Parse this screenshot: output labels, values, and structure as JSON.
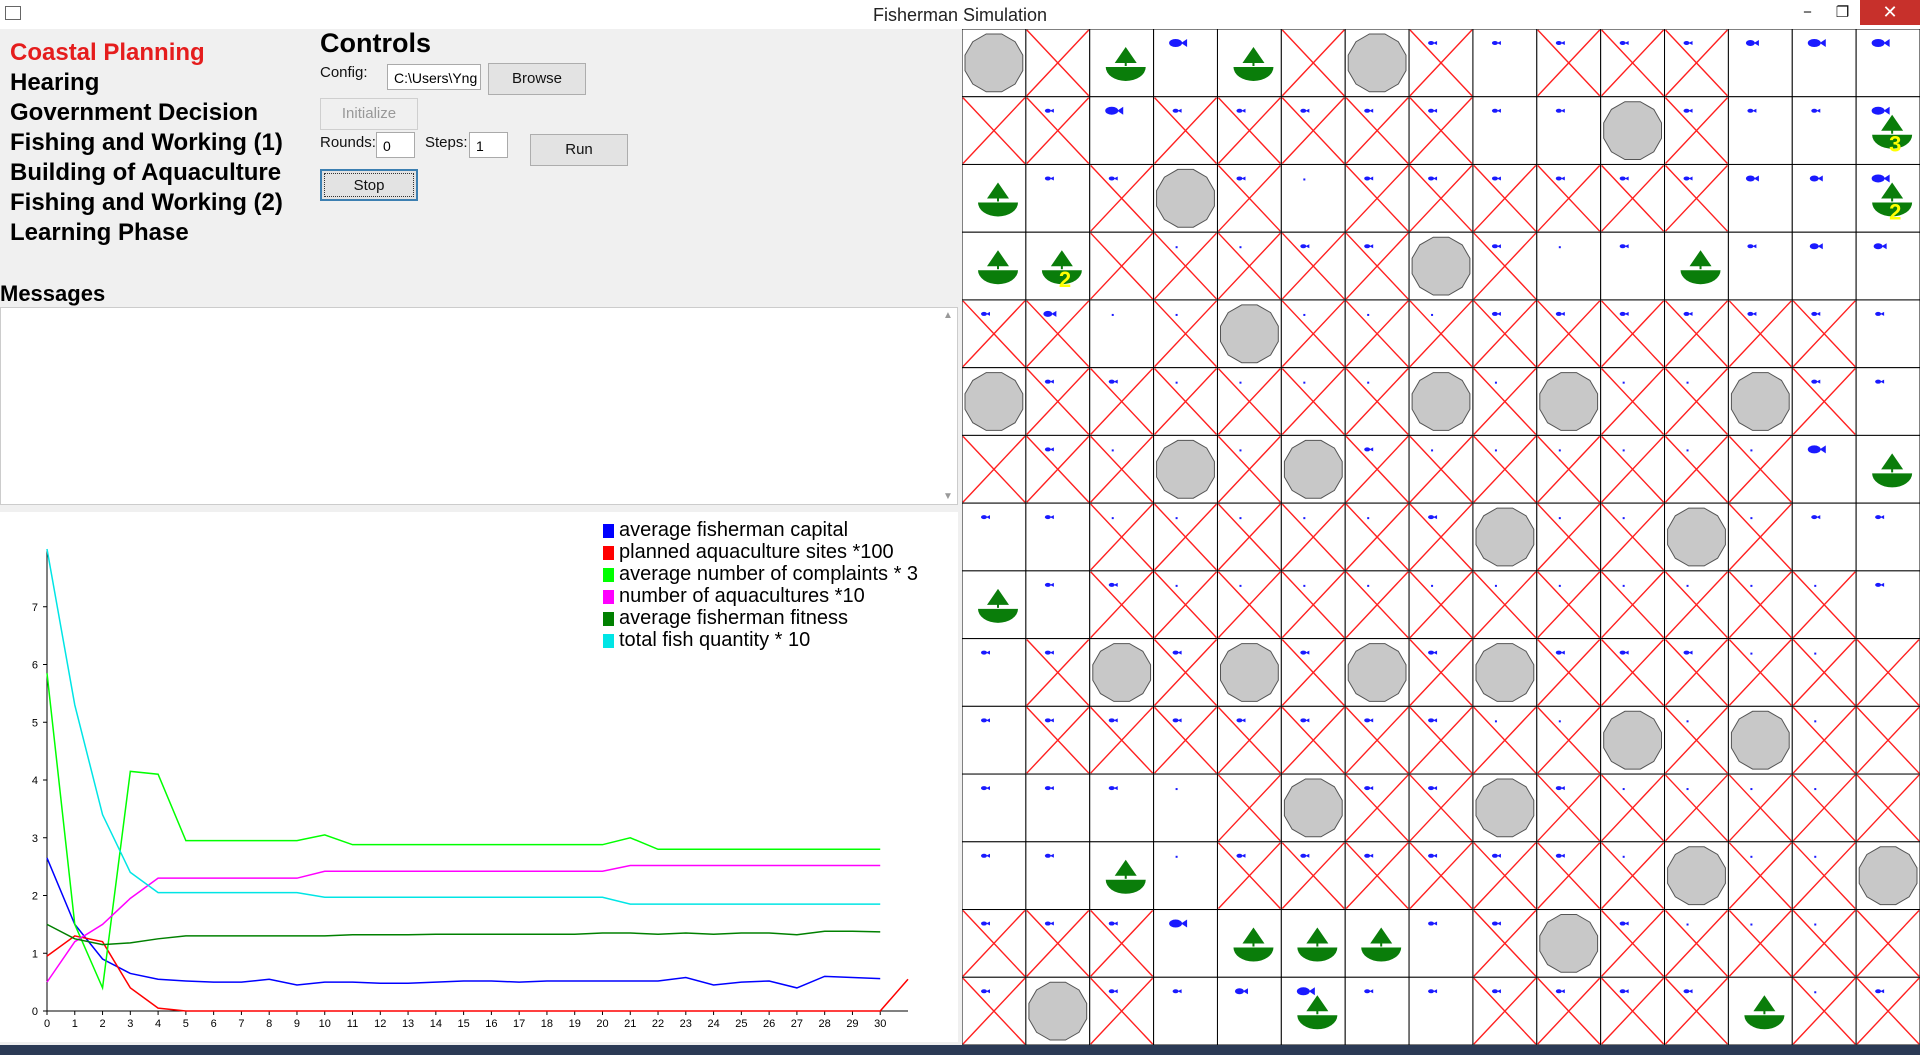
{
  "window": {
    "title": "Fisherman Simulation",
    "minimize": "−",
    "maximize": "❐",
    "close": "✕"
  },
  "phases": [
    {
      "label": "Coastal Planning",
      "active": true
    },
    {
      "label": "Hearing",
      "active": false
    },
    {
      "label": "Government Decision",
      "active": false
    },
    {
      "label": "Fishing and Working (1)",
      "active": false
    },
    {
      "label": "Building of Aquaculture",
      "active": false
    },
    {
      "label": "Fishing and Working (2)",
      "active": false
    },
    {
      "label": "Learning Phase",
      "active": false
    }
  ],
  "controls": {
    "title": "Controls",
    "config_label": "Config:",
    "config_value": "C:\\Users\\Yng",
    "browse": "Browse",
    "initialize": "Initialize",
    "rounds_label": "Rounds:",
    "rounds_value": "0",
    "steps_label": "Steps:",
    "steps_value": "1",
    "run": "Run",
    "stop": "Stop"
  },
  "messages": {
    "label": "Messages",
    "content": ""
  },
  "chart_data": {
    "type": "line",
    "x": [
      0,
      1,
      2,
      3,
      4,
      5,
      6,
      7,
      8,
      9,
      10,
      11,
      12,
      13,
      14,
      15,
      16,
      17,
      18,
      19,
      20,
      21,
      22,
      23,
      24,
      25,
      26,
      27,
      28,
      29,
      30
    ],
    "x_ticks": [
      "0",
      "1",
      "2",
      "3",
      "4",
      "5",
      "6",
      "7",
      "8",
      "9",
      "10",
      "11",
      "12",
      "13",
      "14",
      "15",
      "16",
      "17",
      "18",
      "19",
      "20",
      "21",
      "22",
      "23",
      "24",
      "25",
      "26",
      "27",
      "28",
      "29",
      "30"
    ],
    "y_ticks": [
      "0",
      "1",
      "2",
      "3",
      "4",
      "5",
      "6",
      "7"
    ],
    "ylim": [
      0,
      8
    ],
    "xlim": [
      0,
      31
    ],
    "legend_position": "top-right",
    "series": [
      {
        "name": "average fisherman capital",
        "color": "#0000ff",
        "x": [
          0,
          1,
          2,
          3,
          4,
          5,
          6,
          7,
          8,
          9,
          10,
          11,
          12,
          13,
          14,
          15,
          16,
          17,
          18,
          19,
          20,
          21,
          22,
          23,
          24,
          25,
          26,
          27,
          28,
          29,
          30
        ],
        "values": [
          2.65,
          1.5,
          0.9,
          0.65,
          0.55,
          0.52,
          0.5,
          0.5,
          0.55,
          0.45,
          0.5,
          0.5,
          0.48,
          0.48,
          0.5,
          0.52,
          0.52,
          0.5,
          0.52,
          0.52,
          0.52,
          0.52,
          0.52,
          0.58,
          0.45,
          0.5,
          0.52,
          0.4,
          0.6,
          0.58,
          0.56
        ]
      },
      {
        "name": "planned aquaculture sites *100",
        "color": "#ff0000",
        "x": [
          0,
          1,
          2,
          3,
          4,
          5,
          6,
          7,
          8,
          9,
          10,
          11,
          12,
          13,
          14,
          15,
          16,
          17,
          18,
          19,
          20,
          21,
          22,
          23,
          24,
          25,
          26,
          27,
          28,
          29,
          30,
          31
        ],
        "values": [
          0.95,
          1.3,
          1.2,
          0.4,
          0.05,
          0,
          0,
          0,
          0,
          0,
          0,
          0,
          0,
          0,
          0,
          0,
          0,
          0,
          0,
          0,
          0,
          0,
          0,
          0,
          0,
          0,
          0,
          0,
          0,
          0,
          0,
          0.55
        ]
      },
      {
        "name": "average number of complaints * 3",
        "color": "#00ff00",
        "x": [
          0,
          1,
          2,
          3,
          4,
          5,
          6,
          7,
          8,
          9,
          10,
          11,
          12,
          13,
          14,
          15,
          16,
          17,
          18,
          19,
          20,
          21,
          22,
          23,
          24,
          25,
          26,
          27,
          28,
          29,
          30
        ],
        "values": [
          5.85,
          1.5,
          0.4,
          4.15,
          4.1,
          2.95,
          2.95,
          2.95,
          2.95,
          2.95,
          3.05,
          2.88,
          2.88,
          2.88,
          2.88,
          2.88,
          2.88,
          2.88,
          2.88,
          2.88,
          2.88,
          3.0,
          2.8,
          2.8,
          2.8,
          2.8,
          2.8,
          2.8,
          2.8,
          2.8,
          2.8
        ]
      },
      {
        "name": "number of aquacultures *10",
        "color": "#ff00ff",
        "x": [
          0,
          1,
          2,
          3,
          4,
          5,
          6,
          7,
          8,
          9,
          10,
          11,
          12,
          13,
          14,
          15,
          16,
          17,
          18,
          19,
          20,
          21,
          22,
          23,
          24,
          25,
          26,
          27,
          28,
          29,
          30
        ],
        "values": [
          0.5,
          1.2,
          1.5,
          1.95,
          2.3,
          2.3,
          2.3,
          2.3,
          2.3,
          2.3,
          2.42,
          2.42,
          2.42,
          2.42,
          2.42,
          2.42,
          2.42,
          2.42,
          2.42,
          2.42,
          2.42,
          2.52,
          2.52,
          2.52,
          2.52,
          2.52,
          2.52,
          2.52,
          2.52,
          2.52,
          2.52
        ]
      },
      {
        "name": "average fisherman fitness",
        "color": "#008000",
        "x": [
          0,
          1,
          2,
          3,
          4,
          5,
          6,
          7,
          8,
          9,
          10,
          11,
          12,
          13,
          14,
          15,
          16,
          17,
          18,
          19,
          20,
          21,
          22,
          23,
          24,
          25,
          26,
          27,
          28,
          29,
          30
        ],
        "values": [
          1.5,
          1.25,
          1.15,
          1.18,
          1.25,
          1.3,
          1.3,
          1.3,
          1.3,
          1.3,
          1.3,
          1.32,
          1.32,
          1.32,
          1.33,
          1.33,
          1.33,
          1.33,
          1.33,
          1.33,
          1.35,
          1.35,
          1.33,
          1.35,
          1.33,
          1.35,
          1.35,
          1.32,
          1.38,
          1.38,
          1.37
        ]
      },
      {
        "name": "total fish quantity * 10",
        "color": "#00e5e5",
        "x": [
          0,
          1,
          2,
          3,
          4,
          5,
          6,
          7,
          8,
          9,
          10,
          11,
          12,
          13,
          14,
          15,
          16,
          17,
          18,
          19,
          20,
          21,
          22,
          23,
          24,
          25,
          26,
          27,
          28,
          29,
          30
        ],
        "values": [
          8.0,
          5.3,
          3.4,
          2.4,
          2.05,
          2.05,
          2.05,
          2.05,
          2.05,
          2.05,
          1.97,
          1.97,
          1.97,
          1.97,
          1.97,
          1.97,
          1.97,
          1.97,
          1.97,
          1.97,
          1.97,
          1.85,
          1.85,
          1.85,
          1.85,
          1.85,
          1.85,
          1.85,
          1.85,
          1.85,
          1.85
        ]
      }
    ]
  },
  "map": {
    "cols": 15,
    "rows": 15,
    "icons": {
      "rock": "rock-icon",
      "boat": "boat-icon",
      "fish": "fish-icon",
      "forbidden": "red-x-mark"
    },
    "colors": {
      "rock": "#c8c8c8",
      "boat": "#0a7d0a",
      "fish": "#1a1aff",
      "forbidden": "#ff2020",
      "boat_count": "#ffff00"
    },
    "cells": [
      [
        [
          "R"
        ],
        [
          "X"
        ],
        [
          "B"
        ],
        [
          "F3"
        ],
        [
          "B"
        ],
        [
          "X"
        ],
        [
          "R"
        ],
        [
          "X",
          "F1"
        ],
        [
          "F1"
        ],
        [
          "X",
          "F1"
        ],
        [
          "X",
          "F1"
        ],
        [
          "X",
          "F1"
        ],
        [
          "F2"
        ],
        [
          "F3"
        ],
        [
          "F3"
        ]
      ],
      [
        [
          "X"
        ],
        [
          "X",
          "F1"
        ],
        [
          "F3"
        ],
        [
          "X",
          "F1"
        ],
        [
          "X",
          "F1"
        ],
        [
          "X",
          "F1"
        ],
        [
          "X",
          "F1"
        ],
        [
          "X",
          "F1"
        ],
        [
          "F1"
        ],
        [
          "F1"
        ],
        [
          "R"
        ],
        [
          "X",
          "F1"
        ],
        [
          "F1"
        ],
        [
          "F1"
        ],
        [
          "F3",
          "B:3"
        ]
      ],
      [
        [
          "B"
        ],
        [
          "F1"
        ],
        [
          "X",
          "F1"
        ],
        [
          "R"
        ],
        [
          "X",
          "F1"
        ],
        [
          "F0"
        ],
        [
          "X",
          "F1"
        ],
        [
          "X",
          "F1"
        ],
        [
          "X",
          "F1"
        ],
        [
          "X",
          "F1"
        ],
        [
          "X",
          "F1"
        ],
        [
          "X",
          "F1"
        ],
        [
          "F2"
        ],
        [
          "F2"
        ],
        [
          "F3",
          "B:2"
        ]
      ],
      [
        [
          "B"
        ],
        [
          "B:2"
        ],
        [
          "X"
        ],
        [
          "X",
          "F0"
        ],
        [
          "X",
          "F0"
        ],
        [
          "X",
          "F1"
        ],
        [
          "X",
          "F1"
        ],
        [
          "R"
        ],
        [
          "X",
          "F1"
        ],
        [
          "F0"
        ],
        [
          "F1"
        ],
        [
          "B"
        ],
        [
          "F1"
        ],
        [
          "F2"
        ],
        [
          "F2"
        ]
      ],
      [
        [
          "X",
          "F1"
        ],
        [
          "X",
          "F2"
        ],
        [
          "F0"
        ],
        [
          "X",
          "F0"
        ],
        [
          "R"
        ],
        [
          "X",
          "F0"
        ],
        [
          "X",
          "F0"
        ],
        [
          "X",
          "F0"
        ],
        [
          "X",
          "F1"
        ],
        [
          "X",
          "F1"
        ],
        [
          "X",
          "F1"
        ],
        [
          "X",
          "F1"
        ],
        [
          "X",
          "F1"
        ],
        [
          "X",
          "F1"
        ],
        [
          "F1"
        ]
      ],
      [
        [
          "R"
        ],
        [
          "X",
          "F1"
        ],
        [
          "X",
          "F1"
        ],
        [
          "X",
          "F0"
        ],
        [
          "X",
          "F0"
        ],
        [
          "X",
          "F0"
        ],
        [
          "X",
          "F0"
        ],
        [
          "R"
        ],
        [
          "X",
          "F0"
        ],
        [
          "R"
        ],
        [
          "X",
          "F0"
        ],
        [
          "X",
          "F0"
        ],
        [
          "R"
        ],
        [
          "X",
          "F1"
        ],
        [
          "F1"
        ]
      ],
      [
        [
          "X"
        ],
        [
          "X",
          "F1"
        ],
        [
          "X",
          "F0"
        ],
        [
          "R"
        ],
        [
          "X",
          "F0"
        ],
        [
          "R"
        ],
        [
          "X",
          "F1"
        ],
        [
          "X",
          "F0"
        ],
        [
          "X",
          "F0"
        ],
        [
          "X",
          "F0"
        ],
        [
          "X",
          "F0"
        ],
        [
          "X",
          "F0"
        ],
        [
          "X",
          "F0"
        ],
        [
          "F3"
        ],
        [
          "B"
        ]
      ],
      [
        [
          "F1"
        ],
        [
          "F1"
        ],
        [
          "X",
          "F0"
        ],
        [
          "X",
          "F0"
        ],
        [
          "X",
          "F0"
        ],
        [
          "X",
          "F0"
        ],
        [
          "X",
          "F0"
        ],
        [
          "X",
          "F1"
        ],
        [
          "R"
        ],
        [
          "X",
          "F0"
        ],
        [
          "X",
          "F0"
        ],
        [
          "R"
        ],
        [
          "X",
          "F0"
        ],
        [
          "F1"
        ],
        [
          "F1"
        ]
      ],
      [
        [
          "B"
        ],
        [
          "F1"
        ],
        [
          "X",
          "F1"
        ],
        [
          "X",
          "F0"
        ],
        [
          "X",
          "F0"
        ],
        [
          "X",
          "F0"
        ],
        [
          "X",
          "F0"
        ],
        [
          "X",
          "F0"
        ],
        [
          "X",
          "F0"
        ],
        [
          "X",
          "F0"
        ],
        [
          "X",
          "F0"
        ],
        [
          "X",
          "F0"
        ],
        [
          "X",
          "F0"
        ],
        [
          "X",
          "F0"
        ],
        [
          "F1"
        ]
      ],
      [
        [
          "F1"
        ],
        [
          "X",
          "F1"
        ],
        [
          "R"
        ],
        [
          "X",
          "F1"
        ],
        [
          "R"
        ],
        [
          "X",
          "F1"
        ],
        [
          "R"
        ],
        [
          "X",
          "F1"
        ],
        [
          "R"
        ],
        [
          "X",
          "F1"
        ],
        [
          "X",
          "F1"
        ],
        [
          "X",
          "F1"
        ],
        [
          "X",
          "F0"
        ],
        [
          "X",
          "F0"
        ],
        [
          "X"
        ]
      ],
      [
        [
          "F1"
        ],
        [
          "X",
          "F1"
        ],
        [
          "X",
          "F1"
        ],
        [
          "X",
          "F1"
        ],
        [
          "X",
          "F1"
        ],
        [
          "X",
          "F1"
        ],
        [
          "X",
          "F1"
        ],
        [
          "X",
          "F1"
        ],
        [
          "X",
          "F0"
        ],
        [
          "X",
          "F0"
        ],
        [
          "R"
        ],
        [
          "X",
          "F0"
        ],
        [
          "R"
        ],
        [
          "X",
          "F0"
        ],
        [
          "X"
        ]
      ],
      [
        [
          "F1"
        ],
        [
          "F1"
        ],
        [
          "F1"
        ],
        [
          "F0"
        ],
        [
          "X"
        ],
        [
          "R"
        ],
        [
          "X",
          "F1"
        ],
        [
          "X",
          "F1"
        ],
        [
          "R"
        ],
        [
          "X",
          "F1"
        ],
        [
          "X",
          "F0"
        ],
        [
          "X",
          "F0"
        ],
        [
          "X",
          "F0"
        ],
        [
          "X",
          "F0"
        ],
        [
          "X"
        ]
      ],
      [
        [
          "F1"
        ],
        [
          "F1"
        ],
        [
          "B"
        ],
        [
          "F0"
        ],
        [
          "X",
          "F1"
        ],
        [
          "X",
          "F1"
        ],
        [
          "X",
          "F1"
        ],
        [
          "X",
          "F1"
        ],
        [
          "X",
          "F1"
        ],
        [
          "X",
          "F1"
        ],
        [
          "X",
          "F0"
        ],
        [
          "R"
        ],
        [
          "X",
          "F0"
        ],
        [
          "X",
          "F0"
        ],
        [
          "R"
        ]
      ],
      [
        [
          "X",
          "F1"
        ],
        [
          "X",
          "F1"
        ],
        [
          "X",
          "F1"
        ],
        [
          "F3"
        ],
        [
          "B"
        ],
        [
          "B"
        ],
        [
          "B"
        ],
        [
          "F1"
        ],
        [
          "X",
          "F1"
        ],
        [
          "R"
        ],
        [
          "X",
          "F1"
        ],
        [
          "X",
          "F0"
        ],
        [
          "X",
          "F0"
        ],
        [
          "X",
          "F0"
        ],
        [
          "X"
        ]
      ],
      [
        [
          "X",
          "F1"
        ],
        [
          "R"
        ],
        [
          "X",
          "F1"
        ],
        [
          "F1"
        ],
        [
          "F2"
        ],
        [
          "F3",
          "B"
        ],
        [
          "F1"
        ],
        [
          "F1"
        ],
        [
          "X",
          "F1"
        ],
        [
          "X",
          "F1"
        ],
        [
          "X",
          "F1"
        ],
        [
          "X",
          "F1"
        ],
        [
          "B"
        ],
        [
          "X",
          "F0"
        ],
        [
          "X",
          "F1"
        ]
      ]
    ]
  }
}
